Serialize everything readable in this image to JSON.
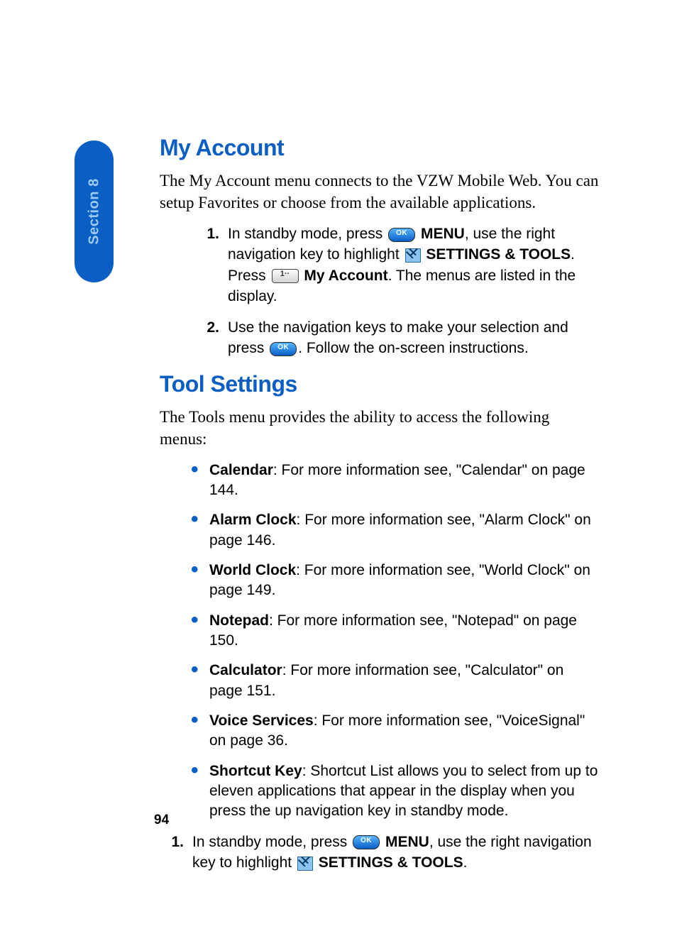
{
  "tab_label": "Section 8",
  "page_number": "94",
  "sections": {
    "my_account": {
      "heading": "My Account",
      "intro": "The My Account menu connects to the VZW Mobile Web. You can setup Favorites or choose from the available applications.",
      "steps": {
        "s1": {
          "num": "1.",
          "a": "In standby mode, press ",
          "menu": "MENU",
          "b": ", use the right navigation key to highlight ",
          "st": "SETTINGS & TOOLS",
          "c": ". Press ",
          "ma": "My Account",
          "d": ". The menus are listed in the display."
        },
        "s2": {
          "num": "2.",
          "a": "Use the navigation keys to make your selection and press ",
          "b": ". Follow the on-screen instructions."
        }
      }
    },
    "tool_settings": {
      "heading": "Tool Settings",
      "intro": "The Tools menu provides the ability to access the following menus:",
      "items": {
        "calendar": {
          "label": "Calendar",
          "rest": ": For more information see, \"Calendar\" on page 144."
        },
        "alarm_clock": {
          "label": "Alarm Clock",
          "rest": ": For more information see, \"Alarm Clock\" on page 146."
        },
        "world_clock": {
          "label": "World Clock",
          "rest": ": For more information see, \"World Clock\" on page 149."
        },
        "notepad": {
          "label": "Notepad",
          "rest": ": For more information see, \"Notepad\" on page 150."
        },
        "calculator": {
          "label": "Calculator",
          "rest": ": For more information see, \"Calculator\" on page 151."
        },
        "voice_services": {
          "label": "Voice Services",
          "rest": ": For more information see, \"VoiceSignal\" on page 36."
        },
        "shortcut_key": {
          "label": "Shortcut Key",
          "rest": ": Shortcut List allows you to select from up to eleven applications that appear in the display when you press the up navigation key in standby mode."
        }
      },
      "substeps": {
        "s1": {
          "num": "1.",
          "a": "In standby mode, press ",
          "menu": "MENU",
          "b": ", use the right navigation key to highlight ",
          "st": "SETTINGS & TOOLS",
          "c": "."
        }
      }
    }
  }
}
